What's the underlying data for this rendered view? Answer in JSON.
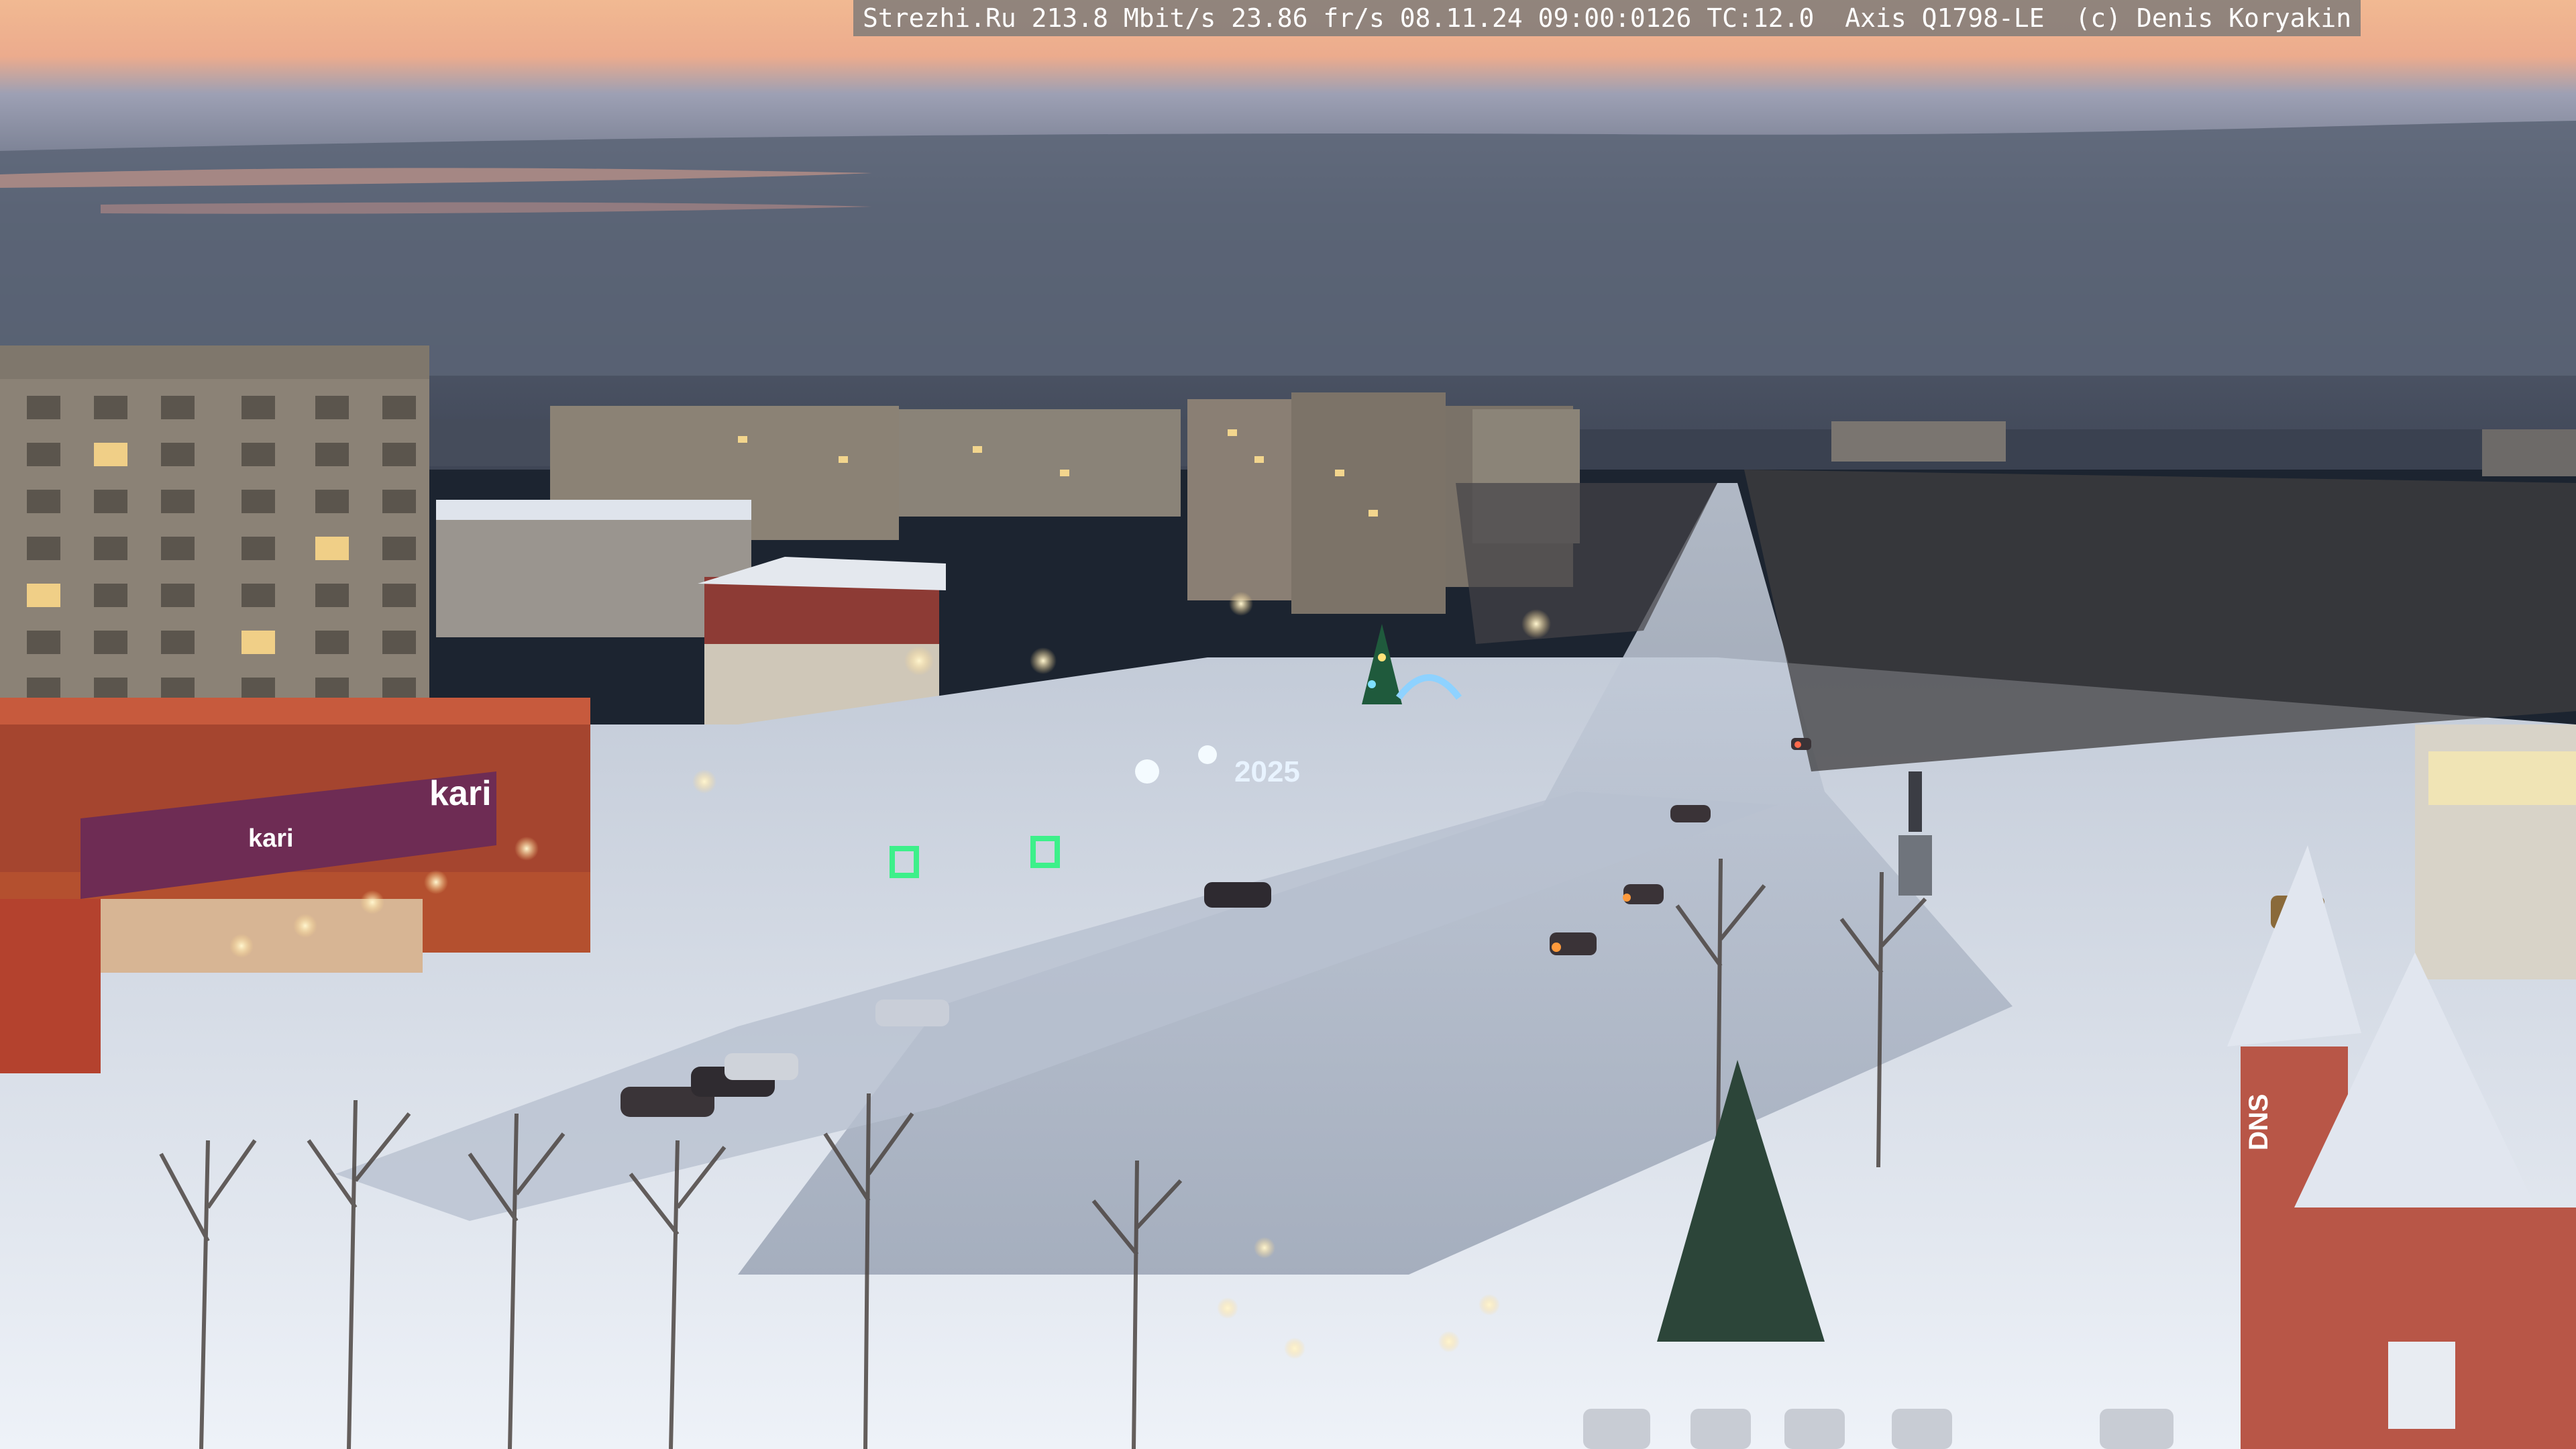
{
  "overlay": {
    "text": "Strezhi.Ru 213.8 Mbit/s 23.86 fr/s 08.11.24 09:00:0126 TC:12.0  Axis Q1798-LE  (c) Denis Koryakin"
  },
  "signs": {
    "store_left": "kari",
    "store_right": "kari",
    "new_year": "2025",
    "dns": "DNS"
  },
  "colors": {
    "sky_top": "#e9b08f",
    "sky_mid": "#8e8fa3",
    "sky_low": "#4c5566",
    "snow": "#dfe6f0",
    "road": "#a9b3c3",
    "store_facade": "#a5452f",
    "store_sign": "#6e2c54"
  }
}
